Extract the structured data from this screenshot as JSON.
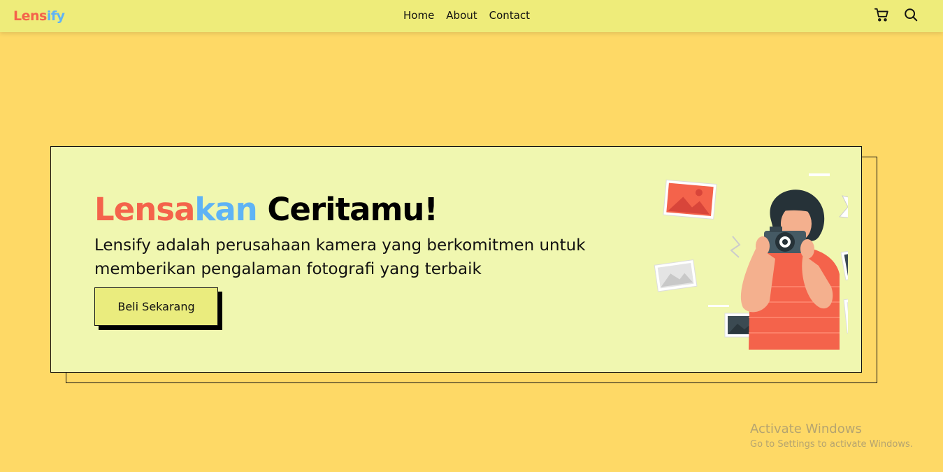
{
  "brand": {
    "part1": "Lens",
    "part2": "ify",
    "color1": "#f4634b",
    "color2": "#5fb3f5"
  },
  "nav": {
    "home": "Home",
    "about": "About",
    "contact": "Contact"
  },
  "icons": {
    "cart": "cart-icon",
    "search": "search-icon"
  },
  "hero": {
    "title_part1": "Lensa",
    "title_part2": "kan",
    "title_part3": " Ceritamu!",
    "description": "Lensify adalah perusahaan kamera yang berkomitmen untuk memberikan pengalaman fotografi yang terbaik",
    "cta_label": "Beli Sekarang",
    "colors": {
      "accent_red": "#f4634b",
      "accent_blue": "#5fb3f5",
      "card_bg": "#f0f7b0",
      "page_bg": "#fed966"
    }
  },
  "watermark": {
    "line1": "Activate Windows",
    "line2": "Go to Settings to activate Windows."
  }
}
